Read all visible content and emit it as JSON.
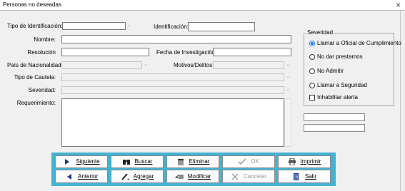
{
  "window": {
    "title": "Personas no deseadas",
    "close_glyph": "×"
  },
  "form": {
    "tipo_identificacion": {
      "label": "Tipo de Identificación:",
      "value": ""
    },
    "identificacion": {
      "label": "Identificación:",
      "value": ""
    },
    "nombre": {
      "label": "Nombre:",
      "value": ""
    },
    "resolucion": {
      "label": "Resolución",
      "value": ""
    },
    "fecha_investigacion": {
      "label": "Fecha de Investigación:",
      "value": ""
    },
    "pais_nacionalidad": {
      "label": "País de Nacionalidad:",
      "value": ""
    },
    "motivos_delitos": {
      "label": "Motivos/Delitos:",
      "value": ""
    },
    "tipo_cautela": {
      "label": "Tipo de Cautela:",
      "value": ""
    },
    "severidad": {
      "label": "Severidad:",
      "value": ""
    },
    "requerimiento": {
      "label": "Requerimiento:",
      "value": ""
    }
  },
  "severidad_group": {
    "title": "Severidad",
    "options": [
      {
        "label": "Llamar a Oficial de Cumplimiento",
        "selected": true
      },
      {
        "label": "No dar prestamos",
        "selected": false
      },
      {
        "label": "No Admitir",
        "selected": false
      },
      {
        "label": "Llamar a Seguridad",
        "selected": false
      }
    ],
    "checkbox": {
      "label": "Inhabilitar alerta",
      "checked": false
    }
  },
  "toolbar": {
    "background": "#43b3d3",
    "buttons": [
      {
        "label": "Siguiente",
        "icon": "triangle-right-icon",
        "enabled": true
      },
      {
        "label": "Buscar",
        "icon": "binoculars-icon",
        "enabled": true
      },
      {
        "label": "Eliminar",
        "icon": "trash-icon",
        "enabled": true
      },
      {
        "label": "OK",
        "icon": "checkmark-icon",
        "enabled": false
      },
      {
        "label": "Imprimir",
        "icon": "printer-icon",
        "enabled": true
      },
      {
        "label": "Anterior",
        "icon": "triangle-left-icon",
        "enabled": true
      },
      {
        "label": "Agregar",
        "icon": "pencil-icon",
        "enabled": true
      },
      {
        "label": "Modificar",
        "icon": "edit-hand-icon",
        "enabled": true
      },
      {
        "label": "Cancelar",
        "icon": "x-icon",
        "enabled": false
      },
      {
        "label": "Salir",
        "icon": "door-exit-icon",
        "enabled": true
      }
    ]
  }
}
